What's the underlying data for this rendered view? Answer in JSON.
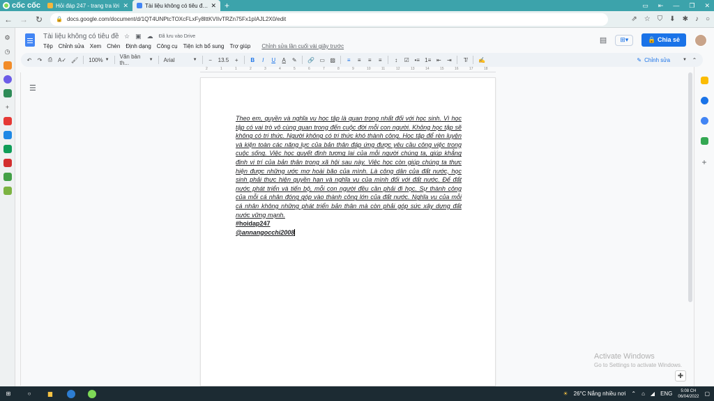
{
  "browser": {
    "brand": "cốc cốc",
    "tabs": [
      {
        "title": "Hỏi đáp 247 - trang tra lời",
        "active": false
      },
      {
        "title": "Tài liệu không có tiêu đề - G",
        "active": true
      }
    ],
    "new_tab": "+",
    "url": "docs.google.com/document/d/1QT4UNPtcTOXcFLxFy8lttKVIIvTRZn75Fx1pIAJL2X0/edit"
  },
  "docs": {
    "title": "Tài liệu không có tiêu đề",
    "saved_status": "Đã lưu vào Drive",
    "menu": [
      "Tệp",
      "Chỉnh sửa",
      "Xem",
      "Chèn",
      "Định dạng",
      "Công cụ",
      "Tiện ích bổ sung",
      "Trợ giúp"
    ],
    "last_edit": "Chỉnh sửa lần cuối vài giây trước",
    "share_label": "Chia sẻ",
    "toolbar": {
      "zoom": "100%",
      "style": "Văn bản th...",
      "font": "Arial",
      "font_size": "13.5",
      "mode": "Chỉnh sửa"
    },
    "ruler_numbers": [
      "2",
      "1",
      "1",
      "2",
      "3",
      "4",
      "5",
      "6",
      "7",
      "8",
      "9",
      "10",
      "11",
      "12",
      "13",
      "14",
      "15",
      "16",
      "17",
      "18"
    ],
    "body_text": "Theo em, quyền và nghĩa vụ học tập là quan trọng nhất đối với học sinh. Vì học tập có vai trò vô cùng quan trong đến cuộc đời mỗi con người. Không học tập sẽ không có tri thức. Người không có tri thức khó thành công. Học tập để rèn luyện và kiện toàn các năng lực của bản thân đáp ứng được yêu cầu công việc trong cuộc sống. Việc học quyết định tương lai của mỗi người chúng ta, giúp khẳng định vị trí của bản thân trong xã hội sau này. Việc học còn giúp chúng ta thực hiện được những ước mơ hoài bão của mình. Là công dân của đất nước, học sinh phải thực hiện quyền hạn và nghĩa vụ của mình đối với đất nước. Để đất nước phát triển và tiến bộ, mỗi con người đều cần phải đi học. Sự thành công của mỗi cá nhân đóng góp vào thành công lớn của đất nước. Nghĩa vụ của mỗi cá nhân không những phát triển bản thân mà còn phải góp sức xây dựng đất nước vững mạnh.",
    "hashtag": "#hoidap247",
    "signature": "@annangocchi2008"
  },
  "watermark": {
    "line1": "Activate Windows",
    "line2": "Go to Settings to activate Windows."
  },
  "taskbar": {
    "weather": "26°C  Nắng nhiều nơi",
    "lang": "ENG",
    "time": "5:08 CH",
    "date": "06/04/2022"
  },
  "colors": {
    "tab_bar": "#3ca3ab",
    "accent": "#1a73e8",
    "taskbar": "#1c2b33"
  }
}
